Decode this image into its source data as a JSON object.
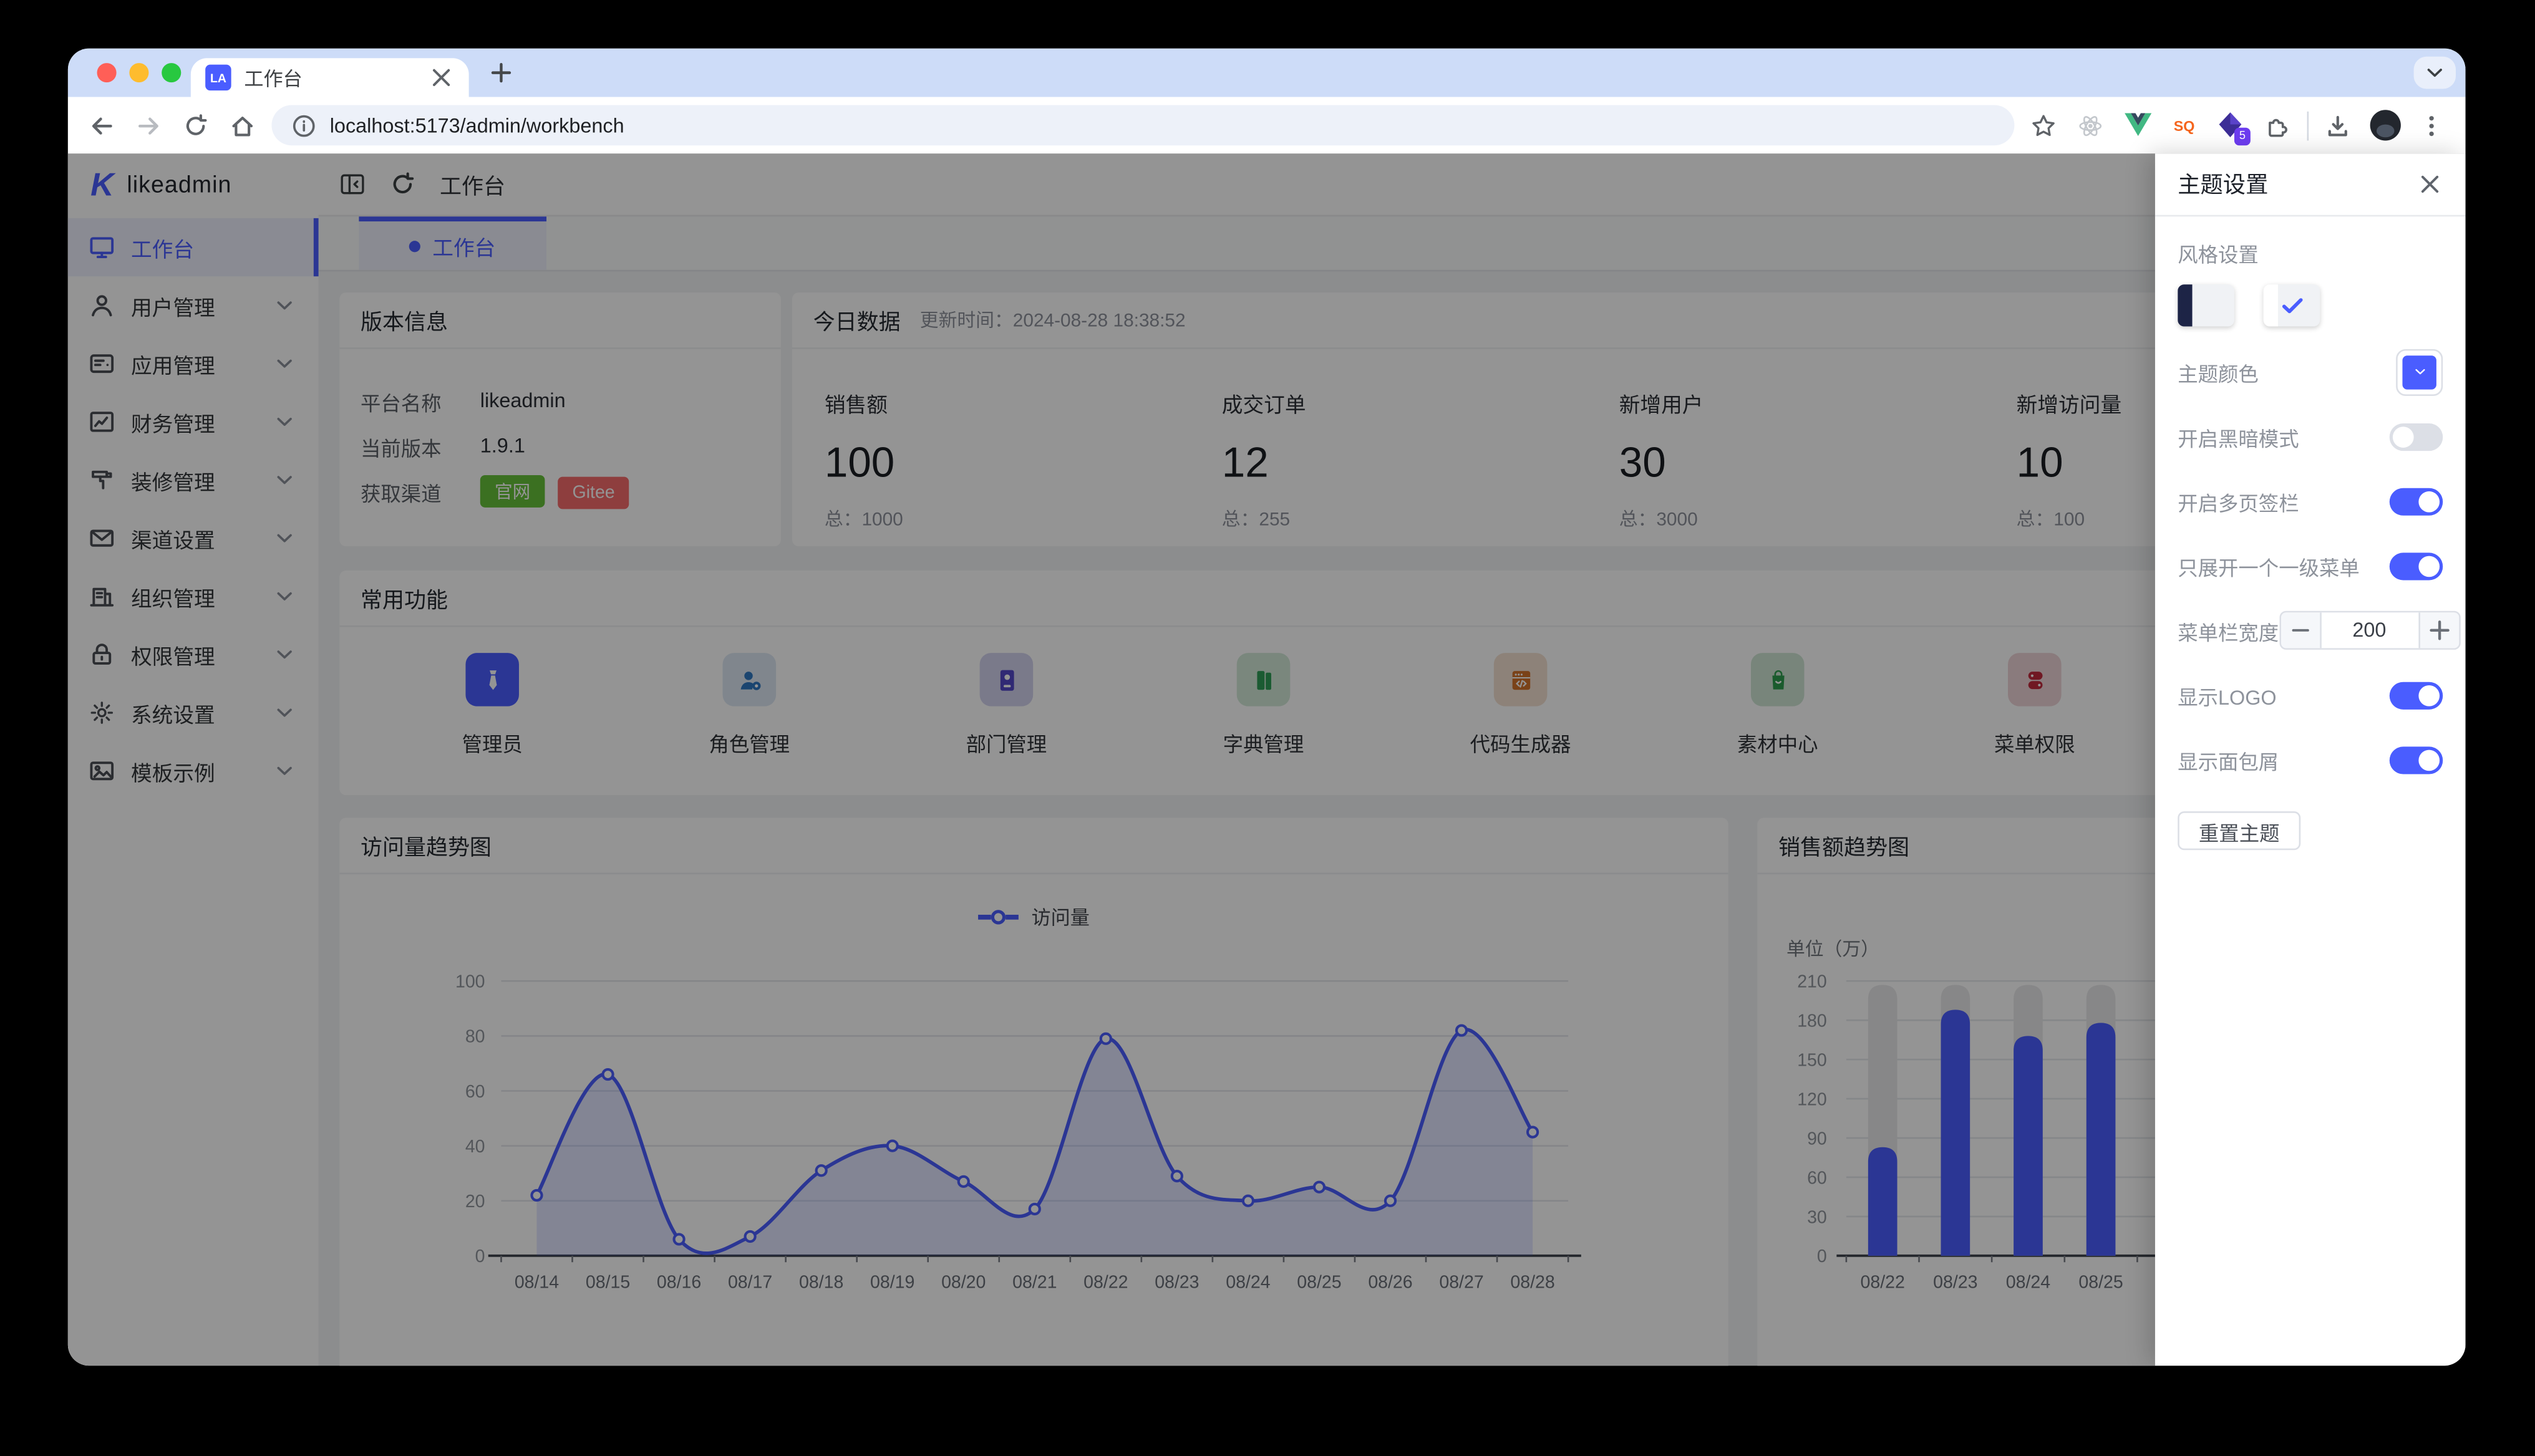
{
  "colors": {
    "accent": "#4a5dff",
    "success": "#67c23a",
    "danger": "#f56c6c"
  },
  "browser": {
    "tab_title": "工作台",
    "favicon": "LA",
    "url": "localhost:5173/admin/workbench",
    "ext_sq": "SQ",
    "extension_badge": "5",
    "toolbar_icons": [
      "back",
      "forward",
      "reload",
      "home",
      "info",
      "star",
      "react",
      "vue",
      "sq",
      "gem",
      "puzzle",
      "download",
      "avatar",
      "kebab"
    ]
  },
  "app": {
    "logo_mark": "K",
    "logo_text": "likeadmin",
    "header": {
      "breadcrumb": "工作台"
    },
    "page_tab": "工作台",
    "sidebar": [
      {
        "label": "工作台",
        "icon": "monitor",
        "active": true,
        "chevron": false
      },
      {
        "label": "用户管理",
        "icon": "user",
        "active": false,
        "chevron": true
      },
      {
        "label": "应用管理",
        "icon": "app",
        "active": false,
        "chevron": true
      },
      {
        "label": "财务管理",
        "icon": "finance",
        "active": false,
        "chevron": true
      },
      {
        "label": "装修管理",
        "icon": "decorate",
        "active": false,
        "chevron": true
      },
      {
        "label": "渠道设置",
        "icon": "channel",
        "active": false,
        "chevron": true
      },
      {
        "label": "组织管理",
        "icon": "org",
        "active": false,
        "chevron": true
      },
      {
        "label": "权限管理",
        "icon": "perm",
        "active": false,
        "chevron": true
      },
      {
        "label": "系统设置",
        "icon": "settings",
        "active": false,
        "chevron": true
      },
      {
        "label": "模板示例",
        "icon": "template",
        "active": false,
        "chevron": true
      }
    ]
  },
  "version_panel": {
    "title": "版本信息",
    "rows": [
      {
        "label": "平台名称",
        "value": "likeadmin"
      },
      {
        "label": "当前版本",
        "value": "1.9.1"
      },
      {
        "label": "获取渠道",
        "buttons": [
          {
            "label": "官网",
            "color": "#67c23a"
          },
          {
            "label": "Gitee",
            "color": "#f56c6c"
          }
        ]
      }
    ]
  },
  "today_panel": {
    "title": "今日数据",
    "update_time": "更新时间：2024-08-28 18:38:52",
    "stats": [
      {
        "label": "销售额",
        "value": "100",
        "total": "总：1000"
      },
      {
        "label": "成交订单",
        "value": "12",
        "total": "总：255"
      },
      {
        "label": "新增用户",
        "value": "30",
        "total": "总：3000"
      },
      {
        "label": "新增访问量",
        "value": "10",
        "total": "总：100"
      }
    ]
  },
  "features_panel": {
    "title": "常用功能",
    "items": [
      {
        "label": "管理员",
        "icon": "tie",
        "bg": "#4a5dff",
        "fg": "#ffffff"
      },
      {
        "label": "角色管理",
        "icon": "usergear",
        "bg": "#dce7f3",
        "fg": "#2f77c1"
      },
      {
        "label": "部门管理",
        "icon": "idcard",
        "bg": "#d3d2ee",
        "fg": "#5348c8"
      },
      {
        "label": "字典管理",
        "icon": "book",
        "bg": "#d2e8d8",
        "fg": "#2f9e57"
      },
      {
        "label": "代码生成器",
        "icon": "code",
        "bg": "#f3e0d0",
        "fg": "#d2722a"
      },
      {
        "label": "素材中心",
        "icon": "bag",
        "bg": "#cfe6d4",
        "fg": "#2e9e4f"
      },
      {
        "label": "菜单权限",
        "icon": "menupill",
        "bg": "#eed5d8",
        "fg": "#c22a3d"
      }
    ]
  },
  "chart_data": [
    {
      "type": "line",
      "title": "访问量趋势图",
      "legend": [
        "访问量"
      ],
      "x": [
        "08/14",
        "08/15",
        "08/16",
        "08/17",
        "08/18",
        "08/19",
        "08/20",
        "08/21",
        "08/22",
        "08/23",
        "08/24",
        "08/25",
        "08/26",
        "08/27",
        "08/28"
      ],
      "series": [
        {
          "name": "访问量",
          "values": [
            22,
            66,
            6,
            7,
            31,
            40,
            27,
            17,
            79,
            29,
            20,
            25,
            20,
            82,
            45
          ]
        }
      ],
      "ylim": [
        0,
        100
      ],
      "yticks": [
        0,
        20,
        40,
        60,
        80,
        100
      ],
      "smooth": true,
      "area": true,
      "legend_position": "top-center",
      "grid": true
    },
    {
      "type": "bar",
      "title": "销售额趋势图",
      "unit_label": "单位（万）",
      "x": [
        "08/22",
        "08/23",
        "08/24",
        "08/25"
      ],
      "series": [
        {
          "name": "销售额",
          "values": [
            83,
            188,
            168,
            178
          ]
        }
      ],
      "ylim": [
        0,
        210
      ],
      "yticks": [
        0,
        30,
        60,
        90,
        120,
        150,
        180,
        210
      ],
      "track_max": 207,
      "grid": true
    }
  ],
  "drawer": {
    "title": "主题设置",
    "style_section": "风格设置",
    "rows": [
      {
        "type": "color",
        "label": "主题颜色"
      },
      {
        "type": "switch",
        "label": "开启黑暗模式",
        "on": false
      },
      {
        "type": "switch",
        "label": "开启多页签栏",
        "on": true
      },
      {
        "type": "switch",
        "label": "只展开一个一级菜单",
        "on": true
      },
      {
        "type": "stepper",
        "label": "菜单栏宽度",
        "value": "200"
      },
      {
        "type": "switch",
        "label": "显示LOGO",
        "on": true
      },
      {
        "type": "switch",
        "label": "显示面包屑",
        "on": true
      }
    ],
    "reset_label": "重置主题"
  }
}
